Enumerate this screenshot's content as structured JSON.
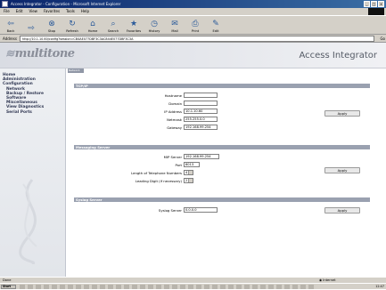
{
  "window": {
    "title": "Access Integrator - Configuration - Microsoft Internet Explorer",
    "controls": [
      "_",
      "□",
      "x"
    ]
  },
  "menu": [
    "File",
    "Edit",
    "View",
    "Favorites",
    "Tools",
    "Help"
  ],
  "toolbar": [
    {
      "label": "Back",
      "glyph": "⇦",
      "icon": "back-arrow-icon"
    },
    {
      "label": "",
      "glyph": "⇨",
      "icon": "forward-arrow-icon"
    },
    {
      "label": "Stop",
      "glyph": "⊗",
      "icon": "stop-icon"
    },
    {
      "label": "Refresh",
      "glyph": "↻",
      "icon": "refresh-icon"
    },
    {
      "label": "Home",
      "glyph": "⌂",
      "icon": "home-icon"
    },
    {
      "label": "Search",
      "glyph": "⌕",
      "icon": "search-icon"
    },
    {
      "label": "Favorites",
      "glyph": "★",
      "icon": "favorites-icon"
    },
    {
      "label": "History",
      "glyph": "◷",
      "icon": "history-icon"
    },
    {
      "label": "Mail",
      "glyph": "✉",
      "icon": "mail-icon"
    },
    {
      "label": "Print",
      "glyph": "⎙",
      "icon": "print-icon"
    },
    {
      "label": "Edit",
      "glyph": "✎",
      "icon": "edit-icon"
    }
  ],
  "address": {
    "label": "Address",
    "url": "http://10.1.10.60/config?session=CB4AE077DBF3C3AC844E077DBF3C3A",
    "go": "Go"
  },
  "header": {
    "logo": "multitone",
    "product": "Access Integrator"
  },
  "breadcrumb": "Network",
  "nav": [
    {
      "label": "Home",
      "sub": false
    },
    {
      "label": "Administration",
      "sub": false
    },
    {
      "label": "Configuration",
      "sub": false
    },
    {
      "label": "Network",
      "sub": true
    },
    {
      "label": "Backup / Restore",
      "sub": true
    },
    {
      "label": "Software",
      "sub": true
    },
    {
      "label": "Miscellaneous",
      "sub": true
    },
    {
      "label": "View Diagnostics",
      "sub": true
    },
    {
      "label": "Serial Ports",
      "sub": true
    }
  ],
  "sections": {
    "tcpip": {
      "title": "TCP/IP",
      "fields": {
        "hostname": {
          "label": "Hostname",
          "value": ""
        },
        "domain": {
          "label": "Domain",
          "value": ""
        },
        "ip": {
          "label": "IP Address",
          "value": "10.1.10.60"
        },
        "netmask": {
          "label": "Netmask",
          "value": "255.255.0.0"
        },
        "gateway": {
          "label": "Gateway",
          "value": "192.168.99.254"
        }
      },
      "apply": "Apply"
    },
    "messaging": {
      "title": "Messaging Server",
      "fields": {
        "mip": {
          "label": "MIP Server",
          "value": "192.168.99.254"
        },
        "port": {
          "label": "Port",
          "value": "6013"
        },
        "telnum": {
          "label": "Length of Telephone Numbers",
          "value": "4"
        },
        "leading": {
          "label": "Leading Digit (if necessary)",
          "value": "2"
        }
      },
      "apply": "Apply"
    },
    "syslog": {
      "title": "Syslog Server",
      "fields": {
        "server": {
          "label": "Syslog Server",
          "value": "0.0.0.0"
        }
      },
      "apply": "Apply"
    }
  },
  "status": {
    "text": "Done",
    "zone": "Internet"
  },
  "taskbar": {
    "start": "Start",
    "clock": "12:47"
  }
}
